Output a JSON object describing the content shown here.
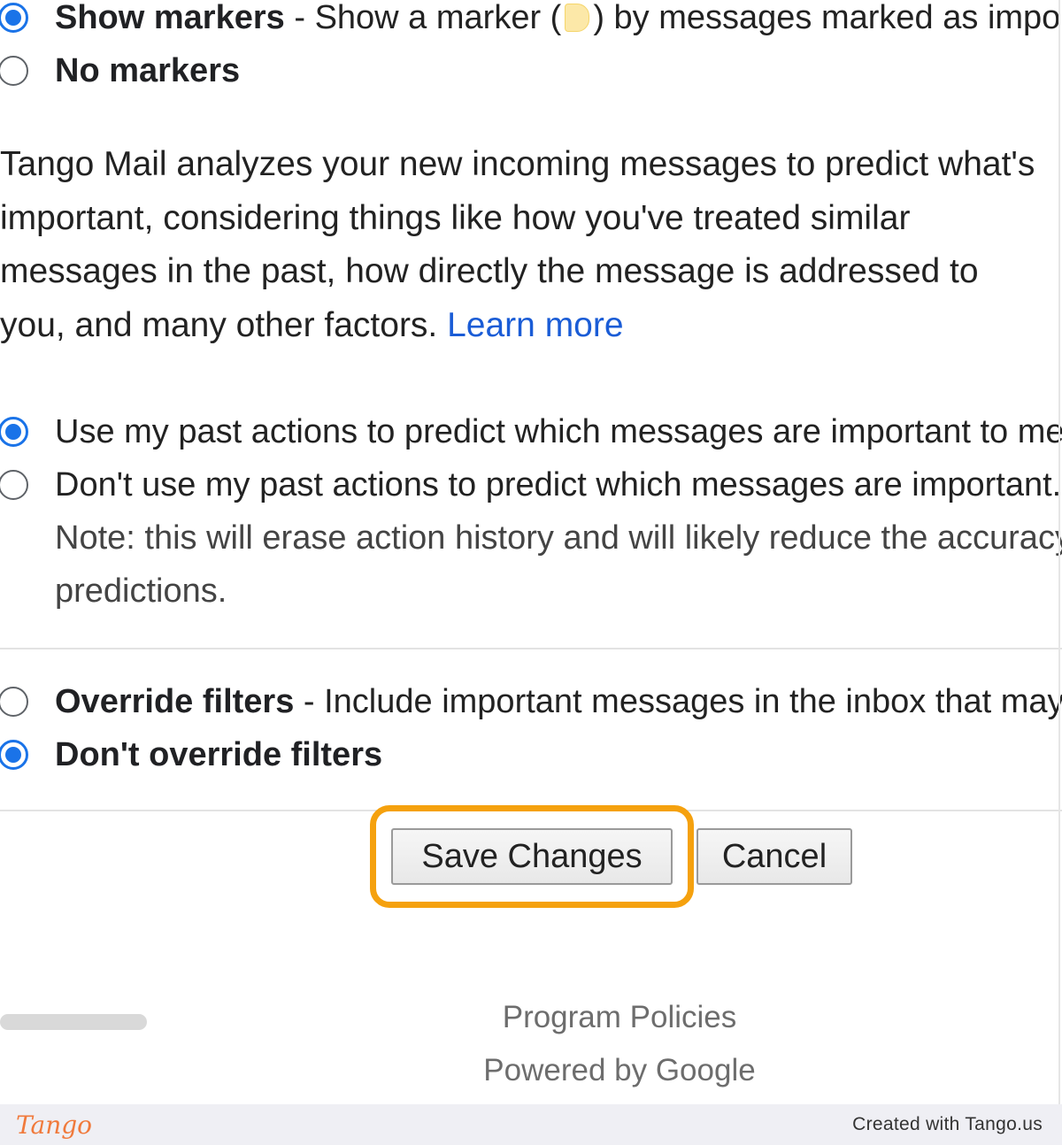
{
  "markers": {
    "show": {
      "label": "Show markers",
      "desc_before": " - Show a marker (",
      "desc_after": ") by messages marked as important.",
      "checked": true
    },
    "none": {
      "label": "No markers",
      "checked": false
    }
  },
  "description": {
    "text": "Tango Mail analyzes your new incoming messages to predict what's important, considering things like how you've treated similar messages in the past, how directly the message is addressed to you, and many other factors. ",
    "link": "Learn more"
  },
  "prediction": {
    "use": {
      "label": "Use my past actions to predict which messages are important to me.",
      "checked": true
    },
    "dont": {
      "label": "Don't use my past actions to predict which messages are important.",
      "checked": false
    },
    "note_line1": "Note: this will erase action history and will likely reduce the accuracy of importance",
    "note_line2": "predictions."
  },
  "filters": {
    "override": {
      "label": "Override filters",
      "desc": " - Include important messages in the inbox that may have been filtered out",
      "checked": false
    },
    "dont": {
      "label": "Don't override filters",
      "checked": true
    }
  },
  "buttons": {
    "save": "Save Changes",
    "cancel": "Cancel"
  },
  "footer": {
    "policies": "Program Policies",
    "powered": "Powered by Google"
  },
  "tango": {
    "logo": "Tango",
    "credit": "Created with Tango.us"
  },
  "colors": {
    "accent": "#1a73e8",
    "highlight": "#f5a10e",
    "link": "#1a5cd6",
    "tango": "#f07a3c"
  }
}
